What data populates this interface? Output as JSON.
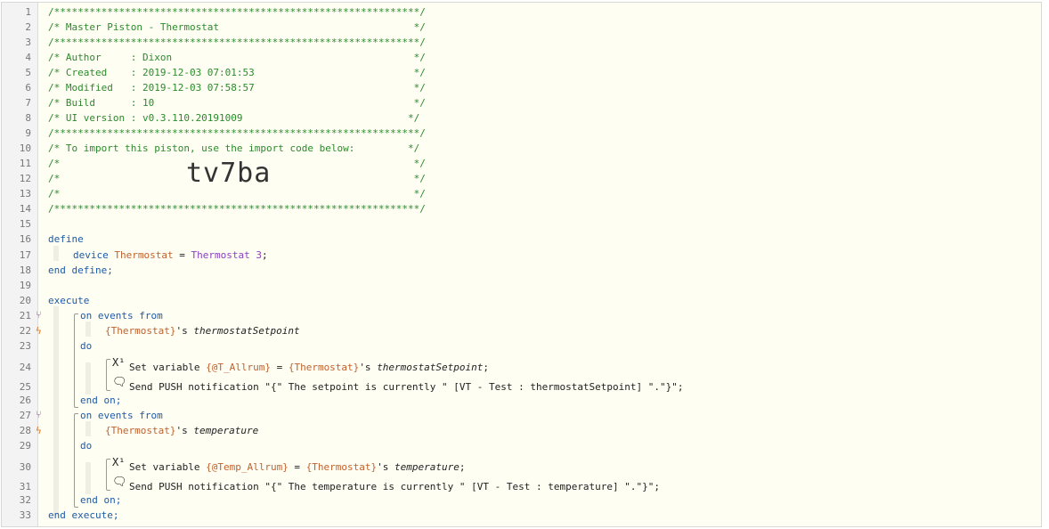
{
  "editor": {
    "line_numbers": [
      "1",
      "2",
      "3",
      "4",
      "5",
      "6",
      "7",
      "8",
      "9",
      "10",
      "11",
      "12",
      "13",
      "14",
      "15",
      "16",
      "17",
      "18",
      "19",
      "20",
      "21",
      "22",
      "23",
      "24",
      "25",
      "26",
      "27",
      "28",
      "29",
      "30",
      "31",
      "32",
      "33"
    ],
    "header": {
      "stars": "/**************************************************************/",
      "title": "/* Master Piston - Thermostat                                 */",
      "author": "/* Author     : Dixon                                         */",
      "created": "/* Created    : 2019-12-03 07:01:53                           */",
      "modified": "/* Modified   : 2019-12-03 07:58:57                           */",
      "build": "/* Build      : 10                                            */",
      "ui_version": "/* UI version : v0.3.110.20191009                            */",
      "import_note": "/* To import this piston, use the import code below:         */",
      "blank": "/*                                                            */",
      "import_code": "tv7ba"
    },
    "define": {
      "open": "define",
      "device_kw": "device",
      "device_name": "Thermostat",
      "equals": " = ",
      "device_value": "Thermostat 3",
      "semicolon": ";",
      "close": "end define;"
    },
    "execute": {
      "open": "execute",
      "close": "end execute;",
      "blocks": [
        {
          "on_events": "on events from",
          "device_ref": "{Thermostat}",
          "attr_suffix": "'s ",
          "attribute": "thermostatSetpoint",
          "do": "do",
          "set_label": "Set variable ",
          "set_var": "{@T_Allrum}",
          "set_eq": " = ",
          "set_device": "{Thermostat}",
          "set_attr_suffix": "'s ",
          "set_attr": "thermostatSetpoint",
          "set_end": ";",
          "push": "Send PUSH notification \"{\" The setpoint is currently \" [VT - Test : thermostatSetpoint] \".\"}\";",
          "end_on": "end on;"
        },
        {
          "on_events": "on events from",
          "device_ref": "{Thermostat}",
          "attr_suffix": "'s ",
          "attribute": "temperature",
          "do": "do",
          "set_label": "Set variable ",
          "set_var": "{@Temp_Allrum}",
          "set_eq": " = ",
          "set_device": "{Thermostat}",
          "set_attr_suffix": "'s ",
          "set_attr": "temperature",
          "set_end": ";",
          "push": "Send PUSH notification \"{\" The temperature is currently \" [VT - Test : temperature] \".\"}\";",
          "end_on": "end on;"
        }
      ]
    },
    "icons": {
      "branch": "branch-icon",
      "trigger": "lightning-icon",
      "variable": "variable-icon",
      "message": "speech-bubble-icon"
    },
    "colors": {
      "background": "#fefef3",
      "comment": "#2c8a2c",
      "keyword": "#1d5aa8",
      "device": "#c0622f",
      "value": "#8a3fbf"
    }
  }
}
